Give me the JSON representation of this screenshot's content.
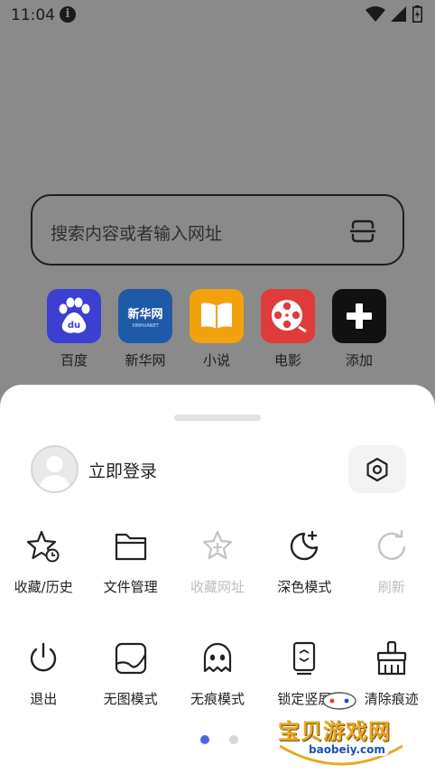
{
  "status_bar": {
    "time": "11:04"
  },
  "search": {
    "placeholder": "搜索内容或者输入网址"
  },
  "shortcuts": [
    {
      "label": "百度",
      "icon": "baidu-icon",
      "color": "#3b3fd2"
    },
    {
      "label": "新华网",
      "icon": "xinhua-icon",
      "color": "#1e5aa8",
      "logo_text": "新华网",
      "logo_sub": "XINHUANET"
    },
    {
      "label": "小说",
      "icon": "book-icon",
      "color": "#f2a20c"
    },
    {
      "label": "电影",
      "icon": "film-reel-icon",
      "color": "#e03b3b"
    },
    {
      "label": "添加",
      "icon": "plus-icon",
      "color": "#111111"
    }
  ],
  "sheet": {
    "login_label": "立即登录",
    "menu_row1": [
      {
        "label": "收藏/历史",
        "icon": "star-clock-icon",
        "enabled": true
      },
      {
        "label": "文件管理",
        "icon": "folder-icon",
        "enabled": true
      },
      {
        "label": "收藏网址",
        "icon": "star-plus-icon",
        "enabled": false
      },
      {
        "label": "深色模式",
        "icon": "moon-icon",
        "enabled": true
      },
      {
        "label": "刷新",
        "icon": "refresh-icon",
        "enabled": false
      }
    ],
    "menu_row2": [
      {
        "label": "退出",
        "icon": "power-icon",
        "enabled": true
      },
      {
        "label": "无图模式",
        "icon": "no-image-icon",
        "enabled": true
      },
      {
        "label": "无痕模式",
        "icon": "ghost-icon",
        "enabled": true
      },
      {
        "label": "锁定竖屏",
        "icon": "lock-portrait-icon",
        "enabled": true
      },
      {
        "label": "清除痕迹",
        "icon": "broom-icon",
        "enabled": true
      }
    ],
    "page_indicator": {
      "pages": 2,
      "current": 1
    }
  },
  "watermark": {
    "text": "宝贝游戏网",
    "sub": "baobeiy.com"
  },
  "colors": {
    "accent": "#4c63e8",
    "overlay": "#8a8a8a",
    "sheet_bg": "#ffffff",
    "disabled": "#bdbdbd"
  }
}
